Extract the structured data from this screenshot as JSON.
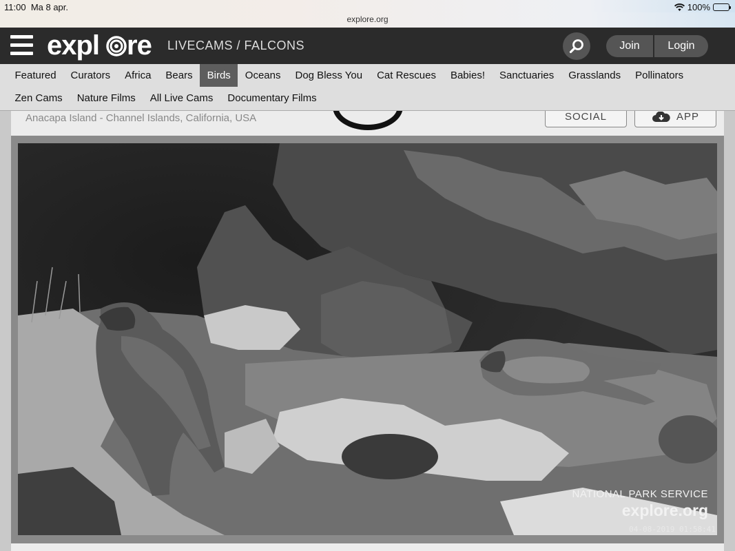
{
  "status_bar": {
    "time": "11:00",
    "date": "Ma 8 apr.",
    "battery": "100%",
    "battery_level": 1.0,
    "wifi_icon": "wifi-icon"
  },
  "browser": {
    "url": "explore.org"
  },
  "header": {
    "logo": "explore",
    "section": "LIVECAMS / FALCONS",
    "join_label": "Join",
    "login_label": "Login",
    "search_icon": "search-icon"
  },
  "nav": {
    "row1": [
      "Featured",
      "Curators",
      "Africa",
      "Bears",
      "Birds",
      "Oceans",
      "Dog Bless You",
      "Cat Rescues",
      "Babies!",
      "Sanctuaries",
      "Grasslands",
      "Pollinators"
    ],
    "row2": [
      "Zen Cams",
      "Nature Films",
      "All Live Cams",
      "Documentary Films"
    ],
    "active": "Birds"
  },
  "cam": {
    "location": "Anacapa Island - Channel Islands, California, USA",
    "social_label": "SOCIAL",
    "app_label": "APP"
  },
  "video": {
    "overlay_credit": "NATIONAL PARK SERVICE",
    "overlay_brand": "explore.org",
    "timestamp": "04-08-2019 01:58:41"
  },
  "colors": {
    "header_bg": "#2b2b2b",
    "nav_bg": "#dedede",
    "nav_active": "#5d5d5d"
  }
}
